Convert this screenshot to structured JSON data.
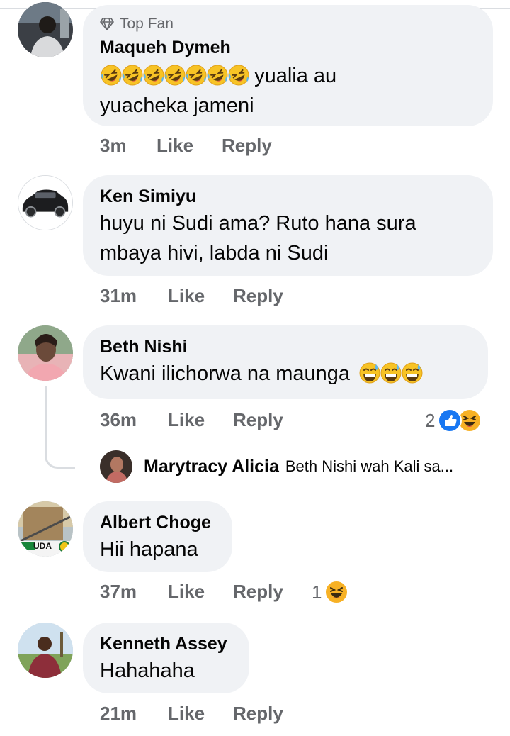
{
  "comments": [
    {
      "badge": "Top Fan",
      "author": "Maqueh Dymeh",
      "text_line1": "yualia au",
      "text_line2": "yuacheka jameni",
      "time": "3m",
      "like": "Like",
      "reply": "Reply",
      "emoji": "rolling-laughing-face",
      "emoji_count": 7
    },
    {
      "author": "Ken Simiyu",
      "text_line1": "huyu ni Sudi ama? Ruto hana sura",
      "text_line2": "mbaya hivi, labda ni Sudi",
      "time": "31m",
      "like": "Like",
      "reply": "Reply"
    },
    {
      "author": "Beth Nishi",
      "text_line1": "Kwani ilichorwa na maunga",
      "time": "36m",
      "like": "Like",
      "reply": "Reply",
      "reaction_count": "2",
      "emoji": "grinning-sweat-face",
      "emoji_count": 3,
      "reply_preview": {
        "author": "Marytracy Alicia",
        "text": "Beth Nishi wah Kali sa..."
      }
    },
    {
      "author": "Albert Choge",
      "avatar_text": "UDA",
      "text_line1": "Hii hapana",
      "time": "37m",
      "like": "Like",
      "reply": "Reply",
      "reaction_count": "1"
    },
    {
      "author": "Kenneth Assey",
      "text_line1": "Hahahaha",
      "time": "21m",
      "like": "Like",
      "reply": "Reply"
    }
  ],
  "colors": {
    "bubble": "#f0f2f5",
    "meta_text": "#65676b",
    "like_blue": "#1877f2",
    "haha_yellow": "#f7b125"
  }
}
